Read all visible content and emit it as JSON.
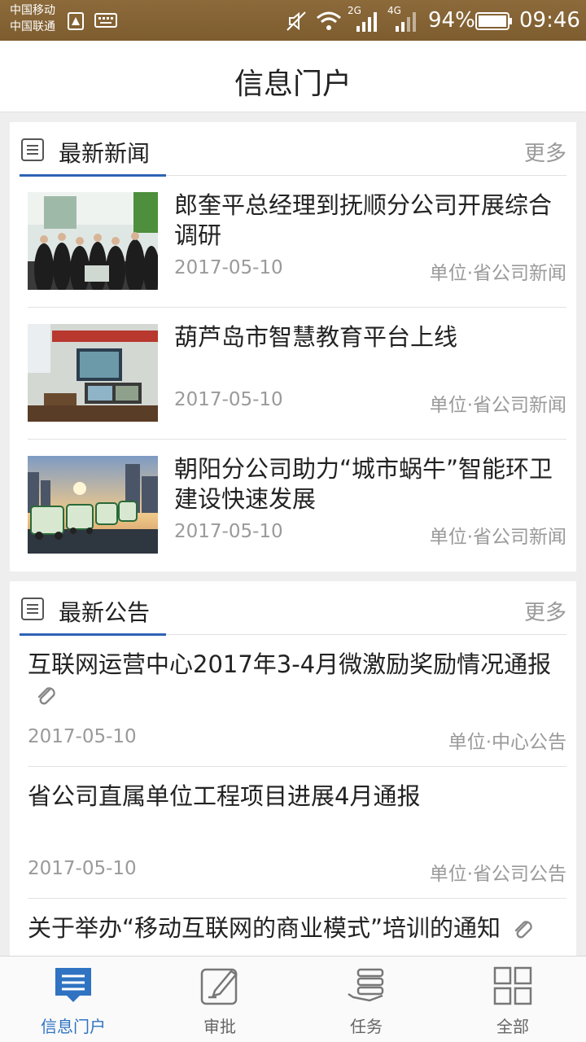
{
  "status_bar": {
    "carrier_1": "中国移动",
    "carrier_2": "中国联通",
    "signal_1_label": "2G",
    "signal_2_label": "4G",
    "battery": "94%",
    "time": "09:46"
  },
  "header": {
    "title": "信息门户"
  },
  "news": {
    "title": "最新新闻",
    "more": "更多",
    "items": [
      {
        "title": "郎奎平总经理到抚顺分公司开展综合调研",
        "date": "2017-05-10",
        "source": "单位·省公司新闻"
      },
      {
        "title": "葫芦岛市智慧教育平台上线",
        "date": "2017-05-10",
        "source": "单位·省公司新闻"
      },
      {
        "title": "朝阳分公司助力“城市蜗牛”智能环卫建设快速发展",
        "date": "2017-05-10",
        "source": "单位·省公司新闻"
      }
    ]
  },
  "notices": {
    "title": "最新公告",
    "more": "更多",
    "items": [
      {
        "title": "互联网运营中心2017年3-4月微激励奖励情况通报",
        "date": "2017-05-10",
        "source": "单位·中心公告",
        "attachment": true
      },
      {
        "title": "省公司直属单位工程项目进展4月通报",
        "date": "2017-05-10",
        "source": "单位·省公司公告",
        "attachment": false
      },
      {
        "title": "关于举办“移动互联网的商业模式”培训的通知",
        "attachment": true
      }
    ]
  },
  "bottom_nav": {
    "active_color": "#2f73c2",
    "items": [
      {
        "label": "信息门户",
        "icon": "portal-icon",
        "active": true
      },
      {
        "label": "审批",
        "icon": "approve-icon",
        "active": false
      },
      {
        "label": "任务",
        "icon": "task-icon",
        "active": false
      },
      {
        "label": "全部",
        "icon": "grid-icon",
        "active": false
      }
    ]
  }
}
